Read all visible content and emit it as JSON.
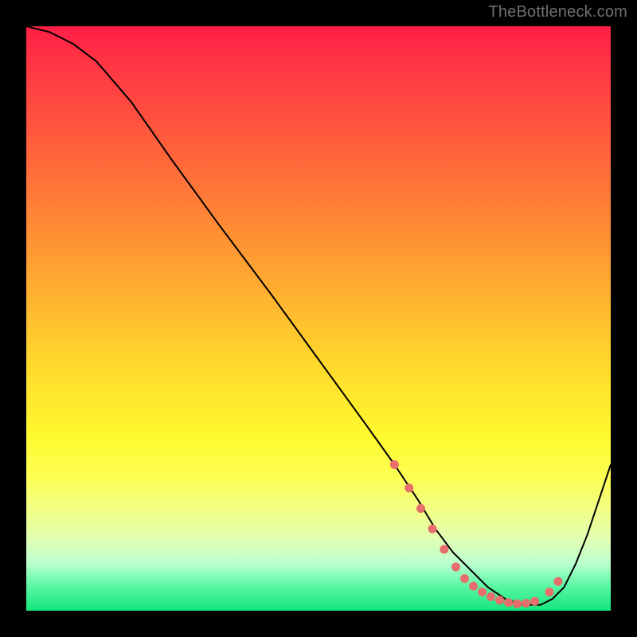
{
  "watermark": "TheBottleneck.com",
  "chart_data": {
    "type": "line",
    "title": "",
    "xlabel": "",
    "ylabel": "",
    "xlim": [
      0,
      100
    ],
    "ylim": [
      0,
      100
    ],
    "grid": false,
    "legend": false,
    "series": [
      {
        "name": "curve",
        "stroke": "#000000",
        "stroke_width": 2,
        "x": [
          0,
          4,
          8,
          12,
          18,
          25,
          33,
          42,
          50,
          58,
          63,
          67,
          70,
          73,
          76,
          79,
          82,
          85,
          88,
          90,
          92,
          94,
          96,
          98,
          100
        ],
        "y": [
          100,
          99,
          97,
          94,
          87,
          77,
          66,
          54,
          43,
          32,
          25,
          19,
          14,
          10,
          7,
          4,
          2,
          1,
          1,
          2,
          4,
          8,
          13,
          19,
          25
        ]
      }
    ],
    "markers": {
      "name": "dotted-segment",
      "fill": "#e86d6d",
      "radius": 5.5,
      "x": [
        63,
        65.5,
        67.5,
        69.5,
        71.5,
        73.5,
        75,
        76.5,
        78,
        79.5,
        81,
        82.5,
        84,
        85.5,
        87,
        89.5,
        91
      ],
      "y": [
        25,
        21,
        17.5,
        14,
        10.5,
        7.5,
        5.5,
        4.2,
        3.2,
        2.4,
        1.8,
        1.4,
        1.2,
        1.3,
        1.6,
        3.2,
        5.0
      ]
    },
    "background_gradient": {
      "stops": [
        {
          "offset": 0,
          "color": "#ff1e47"
        },
        {
          "offset": 24,
          "color": "#ff6a3a"
        },
        {
          "offset": 58,
          "color": "#ffd92c"
        },
        {
          "offset": 77,
          "color": "#fdff52"
        },
        {
          "offset": 92,
          "color": "#b8ffcf"
        },
        {
          "offset": 100,
          "color": "#14e57c"
        }
      ]
    }
  }
}
